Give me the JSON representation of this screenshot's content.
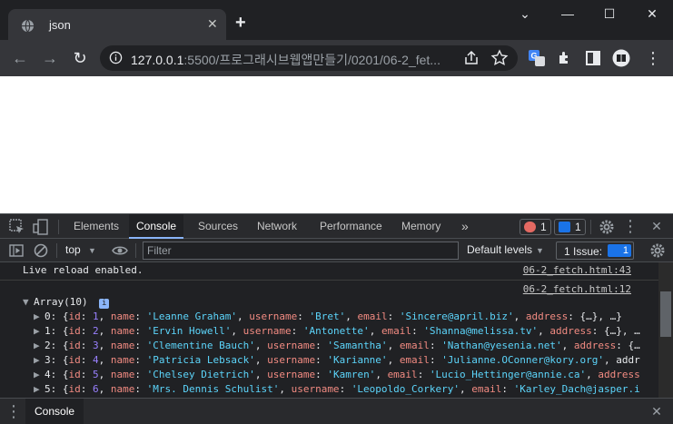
{
  "browser": {
    "tab_title": "json",
    "url_host": "127.0.0.1",
    "url_rest": ":5500/프로그래시브웹앱만들기/0201/06-2_fet..."
  },
  "devtools": {
    "tabs": [
      "Elements",
      "Console",
      "Sources",
      "Network",
      "Performance",
      "Memory"
    ],
    "more": "»",
    "error_count": "1",
    "message_count": "1",
    "context": "top",
    "filter_placeholder": "Filter",
    "levels": "Default levels",
    "issues_label": "1 Issue:",
    "issues_count": "1",
    "drawer_tab": "Console"
  },
  "console": {
    "live_reload": "Live reload enabled.",
    "source1": "06-2_fetch.html:43",
    "source2": "06-2_fetch.html:12",
    "array_label": "Array(10)",
    "rows": [
      {
        "idx": "0",
        "id": "1",
        "name": "'Leanne Graham'",
        "username": "'Bret'",
        "email": "'Sincere@april.biz'",
        "tail": ", address: {…}, …}"
      },
      {
        "idx": "1",
        "id": "2",
        "name": "'Ervin Howell'",
        "username": "'Antonette'",
        "email": "'Shanna@melissa.tv'",
        "tail": ", address: {…}, …"
      },
      {
        "idx": "2",
        "id": "3",
        "name": "'Clementine Bauch'",
        "username": "'Samantha'",
        "email": "'Nathan@yesenia.net'",
        "tail": ", address: {…"
      },
      {
        "idx": "3",
        "id": "4",
        "name": "'Patricia Lebsack'",
        "username": "'Karianne'",
        "email": "'Julianne.OConner@kory.org'",
        "tail": ", addr"
      },
      {
        "idx": "4",
        "id": "5",
        "name": "'Chelsey Dietrich'",
        "username": "'Kamren'",
        "email": "'Lucio_Hettinger@annie.ca'",
        "tail": ", address"
      },
      {
        "idx": "5",
        "id": "6",
        "name": "'Mrs. Dennis Schulist'",
        "username": "'Leopoldo_Corkery'",
        "email": "'Karley_Dach@jasper.i",
        "tail": ""
      }
    ]
  },
  "colors": {
    "accent": "#8ab4f8",
    "error": "#f28b82",
    "string": "#5cd5fb"
  }
}
